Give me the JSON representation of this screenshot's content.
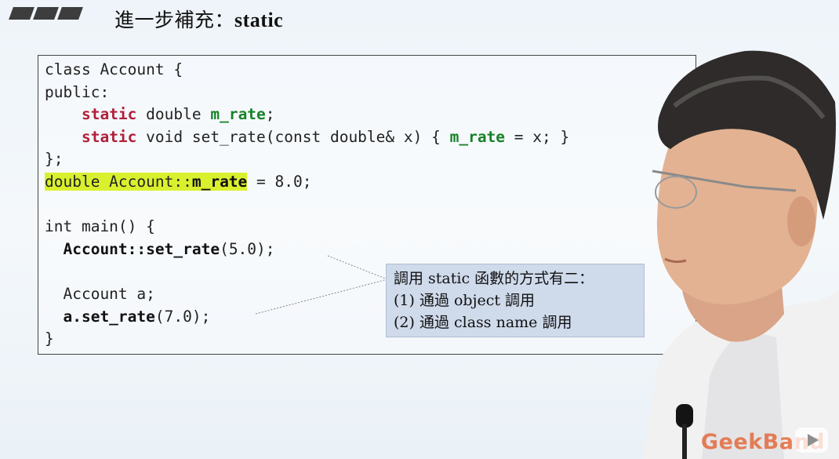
{
  "header": {
    "title_prefix": "進一步補充：",
    "title_keyword": "static"
  },
  "code": {
    "l1": "class Account {",
    "l2": "public:",
    "l3_kw": "static",
    "l3_mid": " double ",
    "l3_mem": "m_rate",
    "l3_end": ";",
    "l4_kw": "static",
    "l4_mid": " void set_rate(const double& x) { ",
    "l4_mem": "m_rate",
    "l4_end": " = x; }",
    "l5": "};",
    "l6_hl_a": "double Account::",
    "l6_hl_b": "m_rate",
    "l6_end": " = 8.0;",
    "l8": "int main() {",
    "l9_bold": "Account::set_rate",
    "l9_end": "(5.0);",
    "l11": "Account a;",
    "l12_bold": "a.set_rate",
    "l12_end": "(7.0);",
    "l13": "}"
  },
  "note": {
    "line1": "調用 static 函數的方式有二：",
    "line2": "(1) 通過 object 調用",
    "line3": "(2) 通過 class name 調用"
  },
  "watermark": {
    "brand": "GeekBand",
    "icon": "play-icon"
  },
  "colors": {
    "keyword": "#b0203a",
    "member": "#18822a",
    "highlight": "#d9f02f",
    "note_bg": "#cfdaeb",
    "brand": "#e36b3d"
  }
}
